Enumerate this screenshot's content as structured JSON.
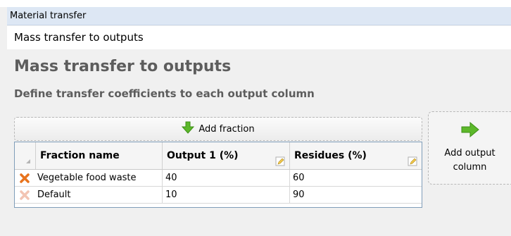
{
  "breadcrumb": "Material transfer",
  "subheader": "Mass transfer to outputs",
  "page": {
    "title": "Mass transfer to outputs",
    "subtitle": "Define transfer coefficients to each output column"
  },
  "toolbar": {
    "add_fraction_label": "Add fraction",
    "add_output_label": "Add output column"
  },
  "grid": {
    "columns": [
      "Fraction name",
      "Output 1 (%)",
      "Residues (%)"
    ],
    "rows": [
      {
        "name": "Vegetable food waste",
        "output1": "40",
        "residues": "60"
      },
      {
        "name": "Default",
        "output1": "10",
        "residues": "90"
      }
    ]
  },
  "colors": {
    "delete_active": "#e8731c",
    "delete_disabled": "#f2c4b3",
    "arrow_green": "#5cb82a"
  }
}
